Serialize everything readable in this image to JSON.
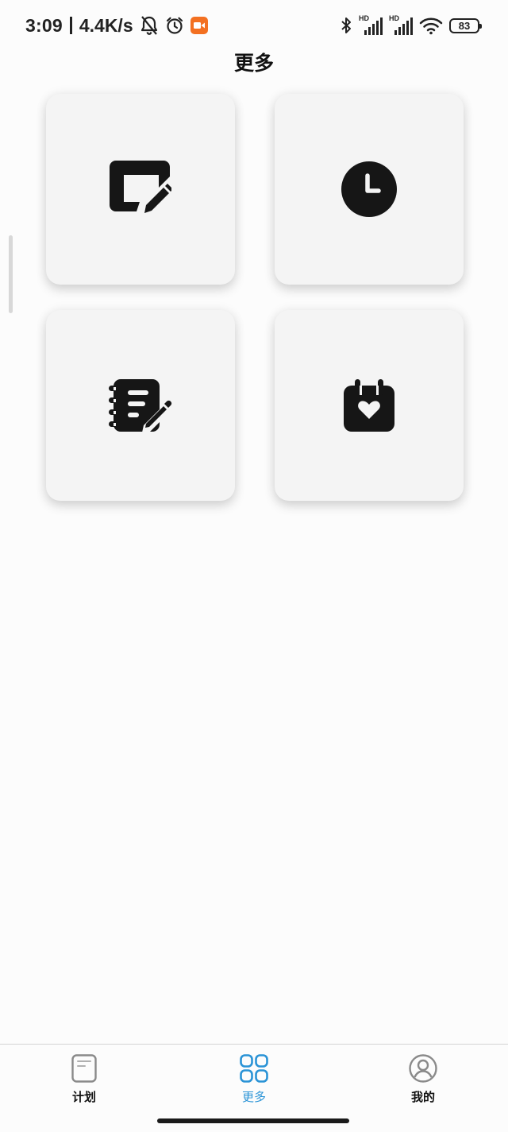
{
  "status_bar": {
    "time": "3:09",
    "net_speed": "4.4K/s",
    "left_icons": [
      "bell-off-icon",
      "alarm-clock-icon",
      "screen-record-icon"
    ],
    "right_icons": [
      "bluetooth-icon",
      "signal-hd-1-icon",
      "signal-hd-2-icon",
      "wifi-icon"
    ],
    "signal_label": "HD",
    "battery": "83",
    "record_color": "#f37021"
  },
  "header": {
    "title": "更多"
  },
  "cards": [
    {
      "icon": "edit-note-icon"
    },
    {
      "icon": "clock-icon"
    },
    {
      "icon": "notebook-edit-icon"
    },
    {
      "icon": "calendar-heart-icon"
    }
  ],
  "bottom_nav": {
    "items": [
      {
        "label": "计划",
        "icon": "document-icon",
        "active": false
      },
      {
        "label": "更多",
        "icon": "grid-icon",
        "active": true
      },
      {
        "label": "我的",
        "icon": "user-icon",
        "active": false
      }
    ],
    "active_color": "#2a93d6"
  }
}
